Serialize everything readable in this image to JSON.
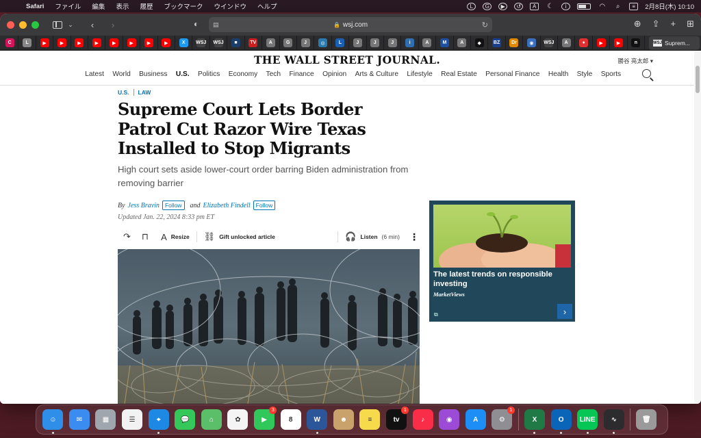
{
  "menubar": {
    "app_name": "Safari",
    "menus": [
      "ファイル",
      "編集",
      "表示",
      "履歴",
      "ブックマーク",
      "ウインドウ",
      "ヘルプ"
    ],
    "status_icons": [
      "line-icon",
      "grammarly-icon",
      "play-icon",
      "history-icon",
      "font-icon",
      "moon-icon",
      "info-icon",
      "battery-icon",
      "wifi-icon",
      "search-icon",
      "control-center-icon"
    ],
    "datetime": "2月8日(木)  10:10"
  },
  "safari": {
    "url": "wsj.com",
    "favorites": [
      {
        "label": "C",
        "color": "#d4145a"
      },
      {
        "label": "L",
        "color": "#888888"
      },
      {
        "label": "▶",
        "color": "#ff0000"
      },
      {
        "label": "▶",
        "color": "#ff0000"
      },
      {
        "label": "▶",
        "color": "#ff0000"
      },
      {
        "label": "▶",
        "color": "#ff0000"
      },
      {
        "label": "▶",
        "color": "#ff0000"
      },
      {
        "label": "▶",
        "color": "#ff0000"
      },
      {
        "label": "▶",
        "color": "#ff0000"
      },
      {
        "label": "▶",
        "color": "#ff0000"
      },
      {
        "label": "X",
        "color": "#1d9bf0"
      },
      {
        "label": "WSJ",
        "color": "#444444"
      },
      {
        "label": "WSJ",
        "color": "#444444"
      },
      {
        "label": "■",
        "color": "#1a3d6a"
      },
      {
        "label": "TV",
        "color": "#cc1f1f"
      },
      {
        "label": "A",
        "color": "#777777"
      },
      {
        "label": "G",
        "color": "#777777"
      },
      {
        "label": "J",
        "color": "#777777"
      },
      {
        "label": "◎",
        "color": "#2a7ab0"
      },
      {
        "label": "L",
        "color": "#1a5fb4"
      },
      {
        "label": "J",
        "color": "#777777"
      },
      {
        "label": "J",
        "color": "#777777"
      },
      {
        "label": "J",
        "color": "#777777"
      },
      {
        "label": "i",
        "color": "#2f6fb0"
      },
      {
        "label": "A",
        "color": "#777777"
      },
      {
        "label": "M",
        "color": "#1e4fa0"
      },
      {
        "label": "A",
        "color": "#777777"
      },
      {
        "label": "◆",
        "color": "#111111"
      },
      {
        "label": "BZ",
        "color": "#1b3f8f"
      },
      {
        "label": "Dr",
        "color": "#e08a00"
      },
      {
        "label": "◉",
        "color": "#3a6fc0"
      },
      {
        "label": "WSJ",
        "color": "#444444"
      },
      {
        "label": "A",
        "color": "#777777"
      },
      {
        "label": "●",
        "color": "#e03030"
      },
      {
        "label": "▶",
        "color": "#ff0000"
      },
      {
        "label": "▶",
        "color": "#ff0000"
      },
      {
        "label": "n",
        "color": "#111111"
      }
    ],
    "active_tab": {
      "icon_label": "WSJ",
      "title": "Suprem..."
    }
  },
  "wsj": {
    "masthead": "THE WALL STREET JOURNAL.",
    "account_name": "勝谷 亮太郎 ▾",
    "nav": [
      "Latest",
      "World",
      "Business",
      "U.S.",
      "Politics",
      "Economy",
      "Tech",
      "Finance",
      "Opinion",
      "Arts & Culture",
      "Lifestyle",
      "Real Estate",
      "Personal Finance",
      "Health",
      "Style",
      "Sports"
    ],
    "nav_active": "U.S.",
    "breadcrumb": [
      "U.S.",
      "LAW"
    ],
    "headline": "Supreme Court Lets Border Patrol Cut Razor Wire Texas Installed to Stop Migrants",
    "dek": "High court sets aside lower-court order barring Biden administration from removing barrier",
    "byline": {
      "by": "By",
      "author1": "Jess Bravin",
      "and": "and",
      "author2": "Elizabeth Findell",
      "follow": "Follow"
    },
    "updated": "Updated Jan. 22, 2024 8:33 pm ET",
    "tools": {
      "resize": "Resize",
      "gift": "Gift unlocked article",
      "listen": "Listen",
      "listen_duration": "(6 min)"
    },
    "ad": {
      "title": "The latest trends on responsible investing",
      "source": "MarketViews"
    }
  },
  "dock": [
    {
      "name": "finder",
      "label": "☺",
      "color": "#2f8fe8",
      "running": true
    },
    {
      "name": "mail",
      "label": "✉",
      "color": "#3b8cf0",
      "running": false
    },
    {
      "name": "launchpad",
      "label": "▦",
      "color": "#a0a6ad",
      "running": false
    },
    {
      "name": "reminders",
      "label": "☰",
      "color": "#f2f2f2",
      "running": false
    },
    {
      "name": "safari",
      "label": "⌖",
      "color": "#1e88e5",
      "running": true
    },
    {
      "name": "messages",
      "label": "💬",
      "color": "#34c759",
      "running": false
    },
    {
      "name": "maps",
      "label": "⌂",
      "color": "#5bbf6a",
      "running": false
    },
    {
      "name": "photos",
      "label": "✿",
      "color": "#f4f4f4",
      "running": false
    },
    {
      "name": "facetime",
      "label": "▶",
      "color": "#30c85a",
      "badge": "3",
      "running": false
    },
    {
      "name": "calendar",
      "label": "8",
      "color": "#ffffff",
      "running": false
    },
    {
      "name": "word",
      "label": "W",
      "color": "#2b579a",
      "running": true
    },
    {
      "name": "contacts",
      "label": "☻",
      "color": "#c9a26b",
      "running": false
    },
    {
      "name": "notes",
      "label": "≡",
      "color": "#f7d94c",
      "running": false
    },
    {
      "name": "apple-tv",
      "label": "tv",
      "color": "#111111",
      "badge": "1",
      "running": false
    },
    {
      "name": "music",
      "label": "♪",
      "color": "#fa2d48",
      "running": false
    },
    {
      "name": "podcasts",
      "label": "◉",
      "color": "#9b4bd6",
      "running": false
    },
    {
      "name": "app-store",
      "label": "A",
      "color": "#1c8ef5",
      "running": false
    },
    {
      "name": "system-settings",
      "label": "⚙",
      "color": "#8e8e93",
      "badge": "1",
      "running": false
    },
    {
      "name": "excel",
      "label": "X",
      "color": "#1f7a45",
      "running": true
    },
    {
      "name": "outlook",
      "label": "O",
      "color": "#0a64b8",
      "running": true
    },
    {
      "name": "line",
      "label": "LINE",
      "color": "#06c755",
      "running": true
    },
    {
      "name": "activity-monitor",
      "label": "∿",
      "color": "#2c2c2e",
      "running": true
    },
    {
      "name": "trash",
      "label": "🗑",
      "color": "#9a9a9a",
      "running": false
    }
  ]
}
